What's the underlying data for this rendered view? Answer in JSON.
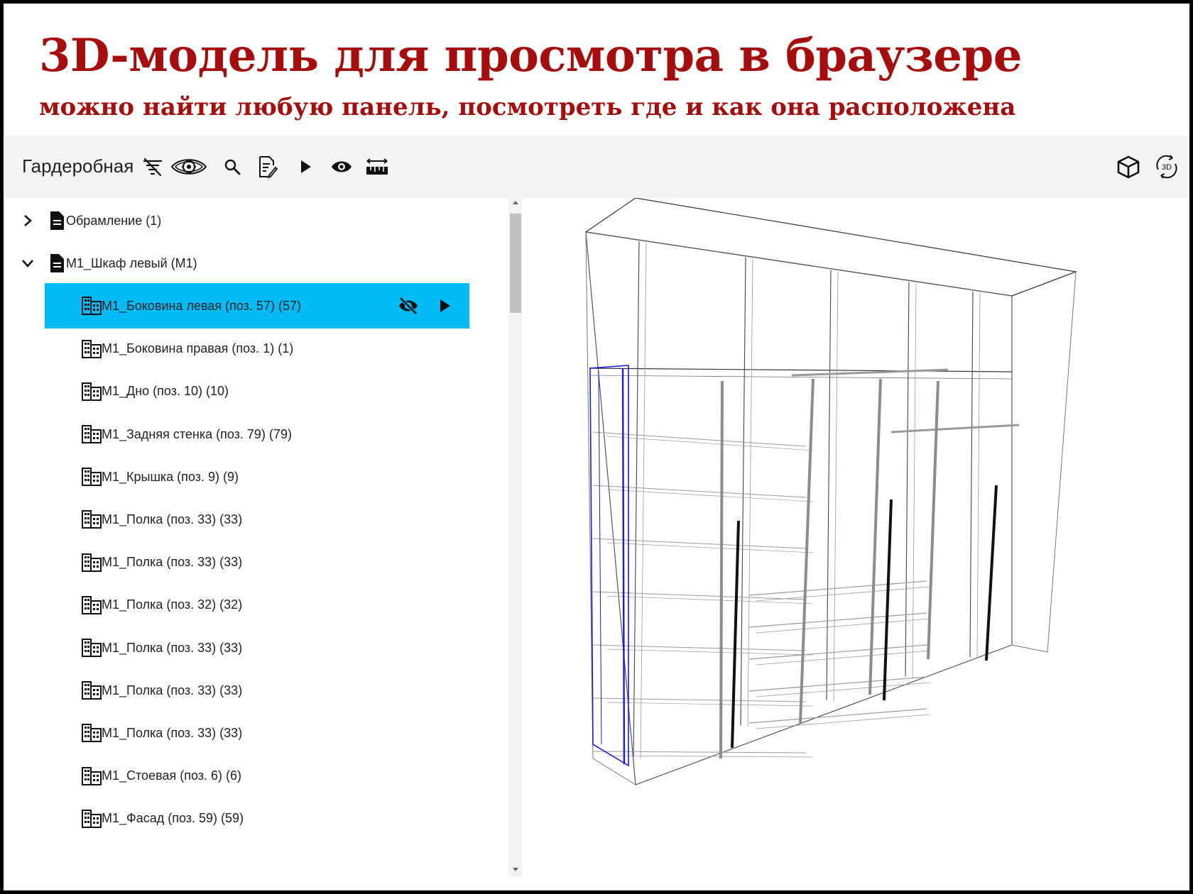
{
  "banner": {
    "title": "3D-модель для просмотра в браузере",
    "subtitle": "можно найти любую панель, посмотреть где и как она расположена"
  },
  "toolbar": {
    "project_name": "Гардеробная",
    "left_icons": [
      "filter-off-icon",
      "eye-gear-icon",
      "search-icon",
      "edit-note-icon",
      "play-icon",
      "eye-icon",
      "ruler-icon"
    ],
    "right_icons": [
      "cube-icon",
      "rotate-3d-icon"
    ],
    "rotate_badge": "3D"
  },
  "tree": {
    "groups": [
      {
        "label": "Обрамление (1)",
        "expanded": false
      },
      {
        "label": "M1_Шкаф левый (M1)",
        "expanded": true
      }
    ],
    "items": [
      {
        "label": "M1_Боковина левая (поз. 57) (57)",
        "selected": true
      },
      {
        "label": "M1_Боковина правая (поз. 1) (1)",
        "selected": false
      },
      {
        "label": "M1_Дно (поз. 10) (10)",
        "selected": false
      },
      {
        "label": "M1_Задняя стенка (поз. 79) (79)",
        "selected": false
      },
      {
        "label": "M1_Крышка (поз. 9) (9)",
        "selected": false
      },
      {
        "label": "M1_Полка (поз. 33) (33)",
        "selected": false
      },
      {
        "label": "M1_Полка (поз. 33) (33)",
        "selected": false
      },
      {
        "label": "M1_Полка (поз. 32) (32)",
        "selected": false
      },
      {
        "label": "M1_Полка (поз. 33) (33)",
        "selected": false
      },
      {
        "label": "M1_Полка (поз. 33) (33)",
        "selected": false
      },
      {
        "label": "M1_Полка (поз. 33) (33)",
        "selected": false
      },
      {
        "label": "M1_Стоевая (поз. 6) (6)",
        "selected": false
      },
      {
        "label": "M1_Фасад (поз. 59) (59)",
        "selected": false
      }
    ],
    "selected_actions": [
      "eye-off-icon",
      "play-icon"
    ]
  },
  "colors": {
    "title": "#a80d0d",
    "selection": "#00bbf6",
    "highlight_edges": "#1a1adc",
    "wireframe": "#9a9a9a"
  }
}
